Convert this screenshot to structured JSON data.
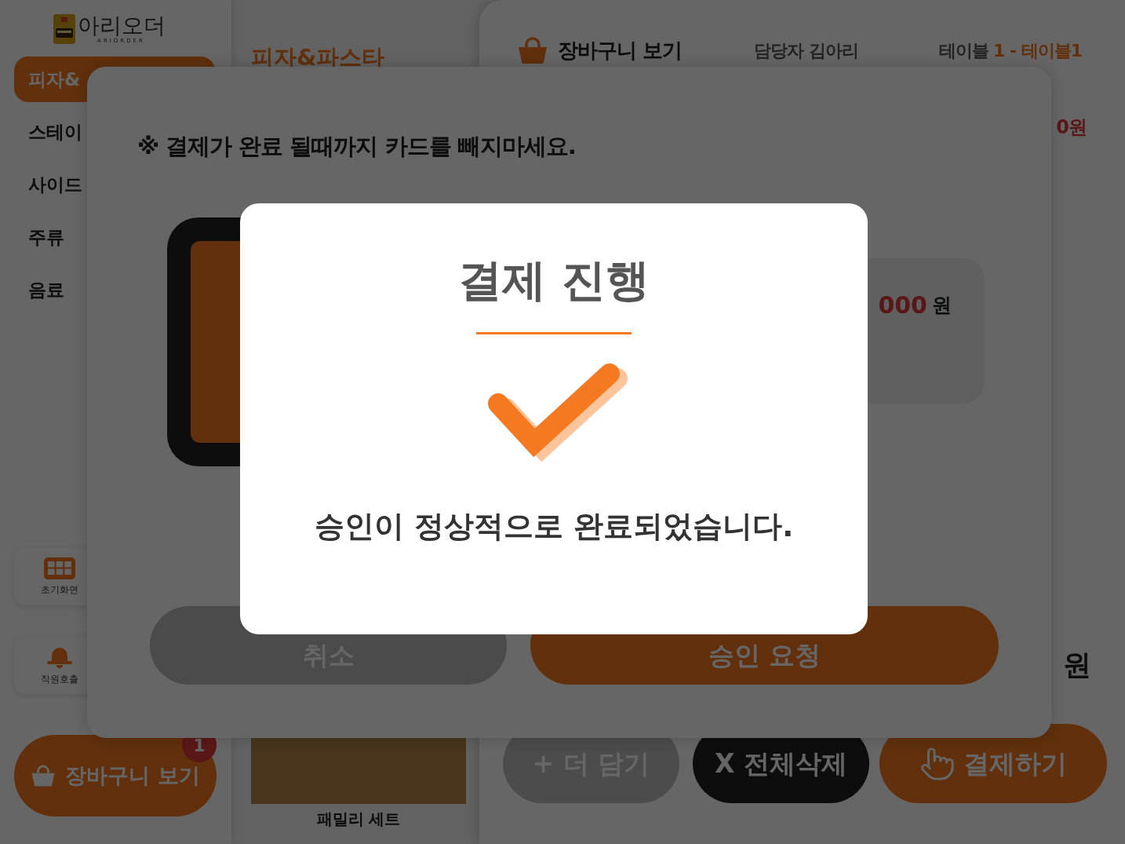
{
  "sidebar": {
    "logo": {
      "name": "아리오더",
      "subtitle": "ARIORDER"
    },
    "categories": [
      {
        "label": "피자&",
        "selected": true
      },
      {
        "label": "스테이",
        "selected": false
      },
      {
        "label": "사이드",
        "selected": false
      },
      {
        "label": "주류",
        "selected": false
      },
      {
        "label": "음료",
        "selected": false
      }
    ],
    "actions": [
      {
        "kind": "home",
        "label": "초기화면"
      },
      {
        "kind": "call",
        "label": "직원호출"
      }
    ],
    "cart_button": {
      "label": "장바구니 보기",
      "badge": "1"
    }
  },
  "menu": {
    "category_title": "피자&파스타",
    "item": {
      "name": "패밀리 세트"
    }
  },
  "cart": {
    "title": "장바구니 보기",
    "staff": "담당자 김아리",
    "table_label": "테이블",
    "table_value": "1 - 테이블1",
    "total": "0원",
    "sum_currency": "원",
    "buttons": [
      {
        "kind": "more",
        "label": "+ 더 담기"
      },
      {
        "kind": "clear",
        "label": "X 전체삭제"
      },
      {
        "kind": "pay",
        "label": "결제하기"
      }
    ]
  },
  "payment_dialog": {
    "notice": "※ 결제가 완료 될때까지 카드를 빼지마세요.",
    "amount": "000",
    "currency": "원",
    "buttons": [
      {
        "kind": "cancel",
        "label": "취소"
      },
      {
        "kind": "confirm",
        "label": "승인 요청"
      }
    ]
  },
  "result_dialog": {
    "title": "결제 진행",
    "message": "승인이 정상적으로 완료되었습니다."
  }
}
